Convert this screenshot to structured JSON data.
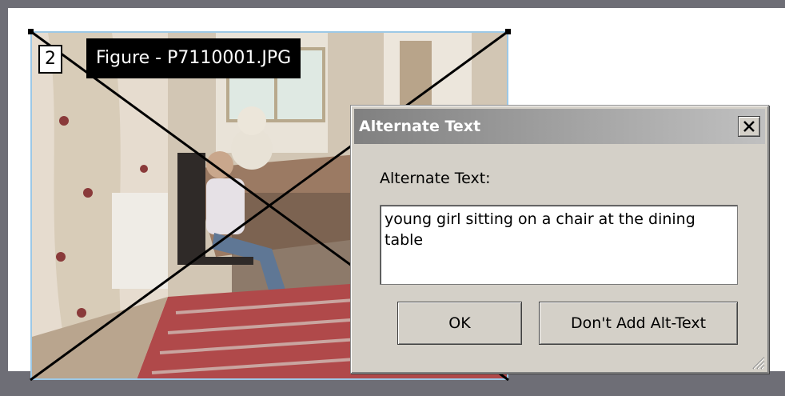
{
  "figure": {
    "badge": "2",
    "label": "Figure - P7110001.JPG"
  },
  "dialog": {
    "title": "Alternate Text",
    "close_glyph": "✕",
    "field_label": "Alternate Text:",
    "alt_text_value": "young girl sitting on a chair at the dining table",
    "ok_label": "OK",
    "no_alt_label": "Don't Add Alt-Text"
  },
  "icons": {
    "close": "close-icon",
    "resize": "resize-grip-icon"
  },
  "colors": {
    "desktop": "#6e6e76",
    "dialog_face": "#d4d0c8",
    "figure_border": "#9cc8e6",
    "title_gradient_start": "#808080"
  }
}
